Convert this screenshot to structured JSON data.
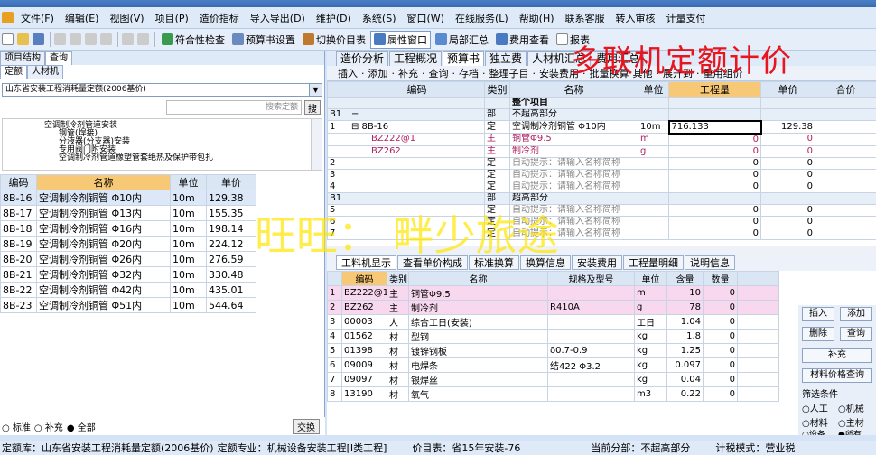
{
  "menu": [
    "文件(F)",
    "编辑(E)",
    "视图(V)",
    "项目(P)",
    "造价指标",
    "导入导出(D)",
    "维护(D)",
    "系统(S)",
    "窗口(W)",
    "在线服务(L)",
    "帮助(H)",
    "联系客服",
    "转入审核",
    "计量支付"
  ],
  "toolbar": [
    "符合性检查",
    "预算书设置",
    "切换价目表",
    "属性窗口",
    "局部汇总",
    "费用查看",
    "报表"
  ],
  "left": {
    "top_tabs": [
      "项目结构",
      "查询"
    ],
    "sub_tabs": [
      "定额",
      "人材机"
    ],
    "quota_select": "山东省安装工程消耗量定额(2006基价)",
    "search_placeholder": "搜索定额",
    "search_btn": "搜",
    "tree": [
      "空调制冷剂管道安装",
      "钢管(焊接)",
      "分液器(分支器)安装",
      "专用阀门附安装",
      "空调制冷剂管道橡塑管套绝热及保护带包扎"
    ],
    "headers": [
      "编码",
      "名称",
      "单位",
      "单价"
    ],
    "rows": [
      [
        "8B-16",
        "空调制冷剂铜管 Φ10内",
        "10m",
        "129.38"
      ],
      [
        "8B-17",
        "空调制冷剂铜管 Φ13内",
        "10m",
        "155.35"
      ],
      [
        "8B-18",
        "空调制冷剂铜管 Φ16内",
        "10m",
        "198.14"
      ],
      [
        "8B-19",
        "空调制冷剂铜管 Φ20内",
        "10m",
        "224.12"
      ],
      [
        "8B-20",
        "空调制冷剂铜管 Φ26内",
        "10m",
        "276.59"
      ],
      [
        "8B-21",
        "空调制冷剂铜管 Φ32内",
        "10m",
        "330.48"
      ],
      [
        "8B-22",
        "空调制冷剂铜管 Φ42内",
        "10m",
        "435.01"
      ],
      [
        "8B-23",
        "空调制冷剂铜管 Φ51内",
        "10m",
        "544.64"
      ]
    ],
    "radio": [
      "标准",
      "补充",
      "全部"
    ],
    "swap_btn": "交换"
  },
  "right": {
    "tabs": [
      "造价分析",
      "工程概况",
      "预算书",
      "独立费",
      "人材机汇总",
      "费用汇总"
    ],
    "tools": [
      "插入",
      "添加",
      "补充",
      "查询",
      "存档",
      "整理子目",
      "安装费用",
      "批量换算",
      "其他",
      "展开到",
      "重用组价"
    ],
    "headers": [
      "编码",
      "类别",
      "名称",
      "单位",
      "工程量",
      "单价",
      "合价"
    ],
    "rows": [
      [
        "",
        "",
        "",
        "整个项目",
        "",
        "",
        ""
      ],
      [
        "B1",
        "−",
        "部",
        "不超高部分",
        "",
        "",
        ""
      ],
      [
        "1",
        "⊟ 8B-16",
        "定",
        "空调制冷剂铜管 Φ10内",
        "10m",
        "716.133",
        "129.38"
      ],
      [
        "",
        "BZ222@1",
        "主",
        "铜管Φ9.5",
        "m",
        "0",
        "0"
      ],
      [
        "",
        "BZ262",
        "主",
        "制冷剂",
        "g",
        "0",
        "0"
      ],
      [
        "2",
        "",
        "定",
        "自动提示：请输入名称简称",
        "",
        "0",
        "0"
      ],
      [
        "3",
        "",
        "定",
        "自动提示：请输入名称简称",
        "",
        "0",
        "0"
      ],
      [
        "4",
        "",
        "定",
        "自动提示：请输入名称简称",
        "",
        "0",
        "0"
      ],
      [
        "B1",
        "",
        "部",
        "超高部分",
        "",
        "",
        ""
      ],
      [
        "5",
        "",
        "定",
        "自动提示：请输入名称简称",
        "",
        "0",
        "0"
      ],
      [
        "6",
        "",
        "定",
        "自动提示：请输入名称简称",
        "",
        "0",
        "0"
      ],
      [
        "7",
        "",
        "定",
        "自动提示：请输入名称简称",
        "",
        "0",
        "0"
      ]
    ],
    "bottom_tabs": [
      "工料机显示",
      "查看单价构成",
      "标准换算",
      "换算信息",
      "安装费用",
      "工程量明细",
      "说明信息"
    ],
    "bheaders": [
      "编码",
      "类别",
      "名称",
      "规格及型号",
      "单位",
      "含量",
      "数量"
    ],
    "brows": [
      [
        "1",
        "BZ222@1",
        "主",
        "铜管Φ9.5",
        "",
        "m",
        "10",
        "0"
      ],
      [
        "2",
        "BZ262",
        "主",
        "制冷剂",
        "R410A",
        "g",
        "78",
        "0"
      ],
      [
        "3",
        "00003",
        "人",
        "综合工日(安装)",
        "",
        "工日",
        "1.04",
        "0"
      ],
      [
        "4",
        "01562",
        "材",
        "型钢",
        "",
        "kg",
        "1.8",
        "0"
      ],
      [
        "5",
        "01398",
        "材",
        "镀锌钢板",
        "δ0.7-0.9",
        "kg",
        "1.25",
        "0"
      ],
      [
        "6",
        "09009",
        "材",
        "电焊条",
        "结422 Φ3.2",
        "kg",
        "0.097",
        "0"
      ],
      [
        "7",
        "09097",
        "材",
        "银焊丝",
        "",
        "kg",
        "0.04",
        "0"
      ],
      [
        "8",
        "13190",
        "材",
        "氧气",
        "",
        "m3",
        "0.22",
        "0"
      ]
    ],
    "side_buttons": [
      "插入",
      "添加",
      "删除",
      "查询",
      "补充",
      "材料价格查询"
    ],
    "filter_label": "筛选条件",
    "filter_opts": [
      "人工",
      "机械",
      "材料",
      "主材",
      "设备",
      "所有"
    ]
  },
  "status": [
    "定额库：山东省安装工程消耗量定额(2006基价)",
    "定额专业：机械设备安装工程[Ⅰ类工程]",
    "价目表：省15年安装-76",
    "当前分部：不超高部分",
    "计税模式：营业税"
  ],
  "watermark1": "多联机定额计价",
  "watermark2": "旺旺： 畔少旅途"
}
